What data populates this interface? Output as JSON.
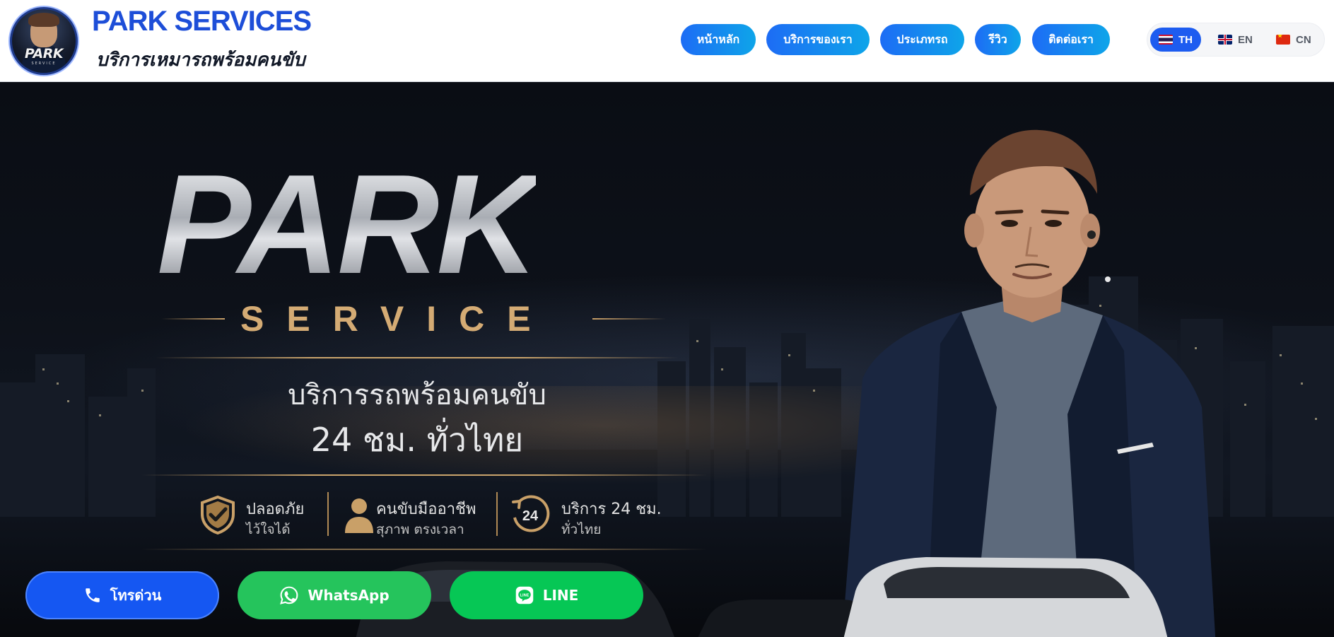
{
  "header": {
    "logo_text": "PARK",
    "logo_sub": "SERVICE",
    "brand_title": "PARK SERVICES",
    "brand_subtitle": "บริการเหมารถพร้อมคนขับ"
  },
  "nav": {
    "items": [
      {
        "label": "หน้าหลัก"
      },
      {
        "label": "บริการของเรา"
      },
      {
        "label": "ประเภทรถ"
      },
      {
        "label": "รีวิว"
      },
      {
        "label": "ติดต่อเรา"
      }
    ]
  },
  "languages": {
    "selected": "TH",
    "items": [
      {
        "code": "TH",
        "flag": "thailand-flag-icon"
      },
      {
        "code": "EN",
        "flag": "uk-flag-icon"
      },
      {
        "code": "CN",
        "flag": "china-flag-icon"
      }
    ]
  },
  "hero": {
    "park": "PARK",
    "service": "SERVICE",
    "line1": "บริการรถพร้อมคนขับ",
    "line2": "24 ชม. ทั่วไทย",
    "features": [
      {
        "icon": "shield-check-icon",
        "title": "ปลอดภัย",
        "subtitle": "ไว้ใจได้"
      },
      {
        "icon": "driver-person-icon",
        "title": "คนขับมืออาชีพ",
        "subtitle": "สุภาพ ตรงเวลา"
      },
      {
        "icon": "clock-24-icon",
        "title": "บริการ 24 ชม.",
        "subtitle": "ทั่วไทย"
      }
    ]
  },
  "cta": {
    "call": {
      "label": "โทรด่วน",
      "icon": "phone-icon"
    },
    "whatsapp": {
      "label": "WhatsApp",
      "icon": "whatsapp-icon"
    },
    "line": {
      "label": "LINE",
      "icon": "line-icon"
    }
  },
  "colors": {
    "brand_blue": "#1d4ed8",
    "nav_gradient_start": "#1d6cf5",
    "nav_gradient_end": "#0ea5e9",
    "gold": "#d4ab74",
    "whatsapp_green": "#25c45c",
    "line_green": "#06c755",
    "call_blue": "#1557f2"
  }
}
